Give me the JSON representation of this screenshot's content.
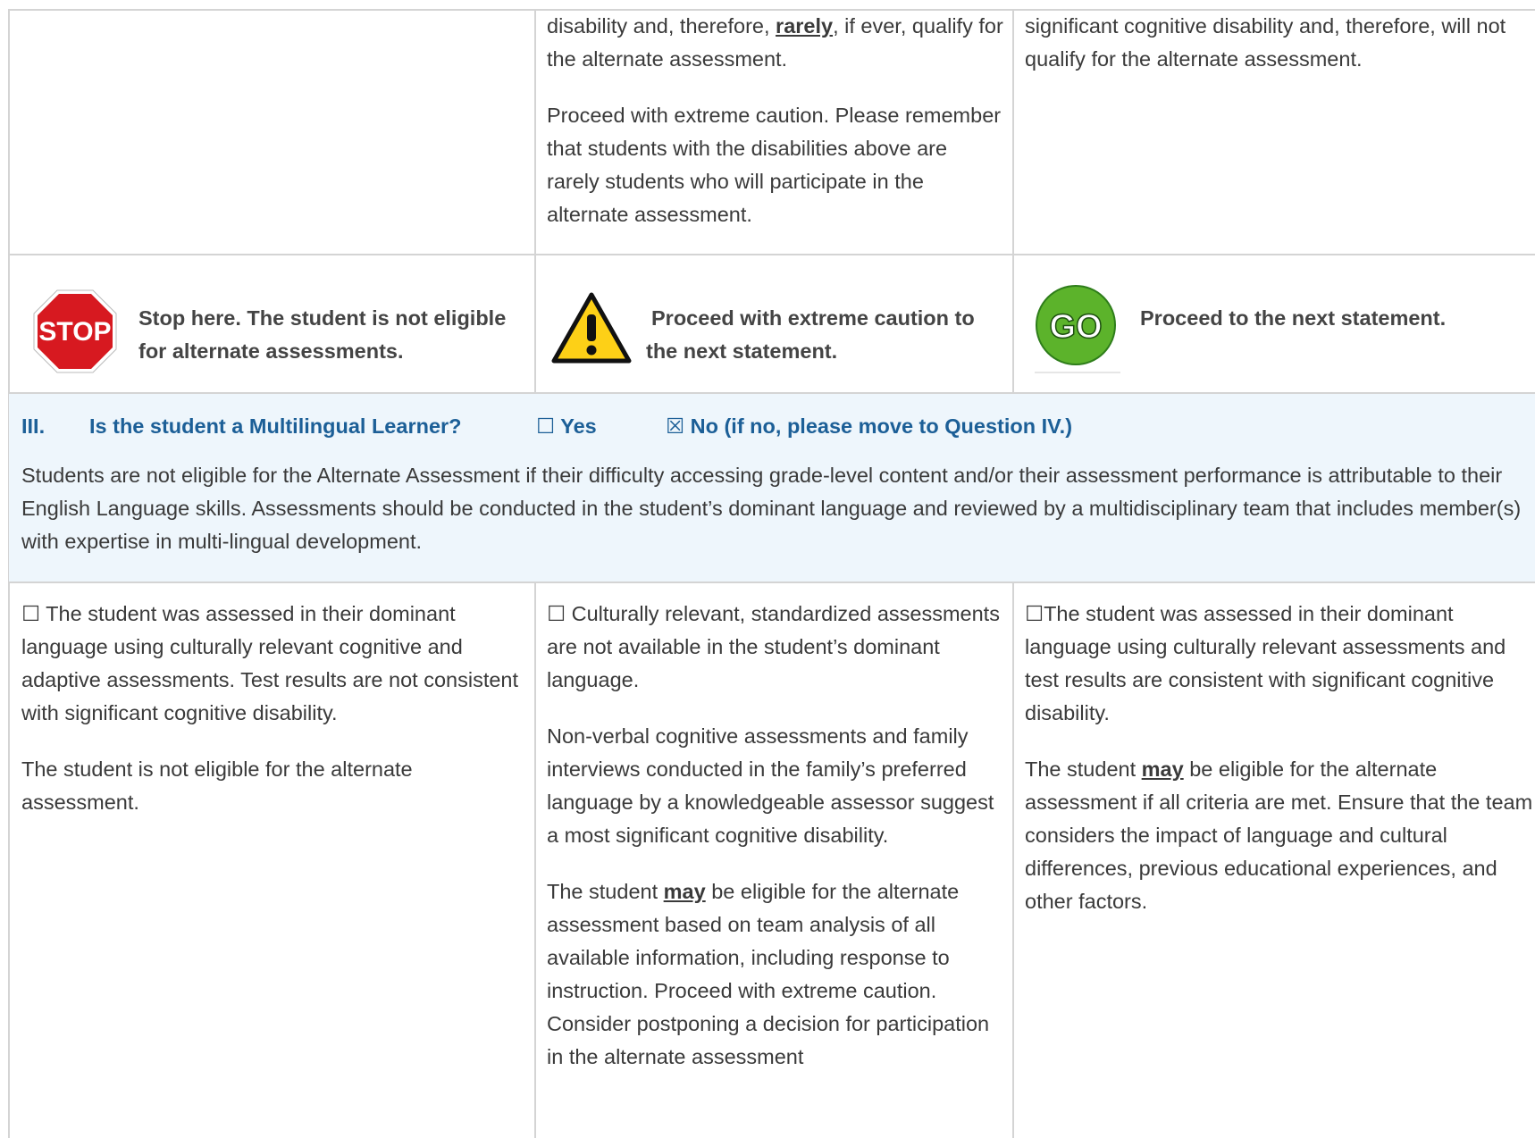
{
  "top_row": {
    "col2_p1_a": "disability and, therefore, ",
    "col2_p1_emph": "rarely",
    "col2_p1_b": ", if ever, qualify for the alternate assessment.",
    "col2_p2": "Proceed with extreme caution. Please remember that students with the disabilities above are rarely students who will participate in the alternate assessment.",
    "col3_p1": "significant cognitive disability and, therefore, will not qualify for the alternate assessment."
  },
  "signals": {
    "stop_icon_text": "STOP",
    "stop_text": "Stop here. The student is not eligible for alternate assessments.",
    "caution_text": "Proceed with extreme caution to the next statement.",
    "go_icon_text": "GO",
    "go_text": "Proceed to the next statement."
  },
  "question3": {
    "number": "III.",
    "question": "Is the student a Multilingual Learner?",
    "yes_box": "☐",
    "yes_label": "Yes",
    "no_box": "☒",
    "no_label": "No (if no, please move to Question IV.)",
    "description": "Students are not eligible for the Alternate Assessment if their difficulty accessing grade-level content and/or their assessment performance is attributable to their English Language skills. Assessments should be conducted in the student’s dominant language and reviewed by a multidisciplinary team that includes member(s) with expertise in multi-lingual development."
  },
  "bottom_row": {
    "col1_p1": "☐ The student was assessed in their dominant language using culturally relevant cognitive and adaptive assessments. Test results are not consistent with significant cognitive disability.",
    "col1_p2": "The student is not eligible for the alternate assessment.",
    "col2_p1": "☐ Culturally relevant, standardized assessments are not available in the student’s dominant language.",
    "col2_p2": "Non-verbal cognitive assessments and family interviews conducted in the family’s preferred language by a knowledgeable assessor suggest a most significant cognitive disability.",
    "col2_p3_a": "The student ",
    "col2_p3_emph": "may",
    "col2_p3_b": " be eligible for the alternate assessment based on team analysis of all available information, including response to instruction. Proceed with extreme caution. Consider postponing a decision for participation in the alternate assessment",
    "col3_p1": "☐The student was assessed in their dominant language using culturally relevant assessments and test results are consistent with significant cognitive disability.",
    "col3_p2_a": "The student ",
    "col3_p2_emph": "may",
    "col3_p2_b": " be eligible for the alternate assessment if all criteria are met. Ensure that the team considers the impact of language and cultural differences, previous educational experiences, and other factors."
  },
  "colors": {
    "heading_blue": "#1c5f97",
    "band_bg": "#eef6fc",
    "stop_red": "#d71920",
    "caution_yellow": "#fdd017",
    "go_green": "#5cb32b"
  }
}
